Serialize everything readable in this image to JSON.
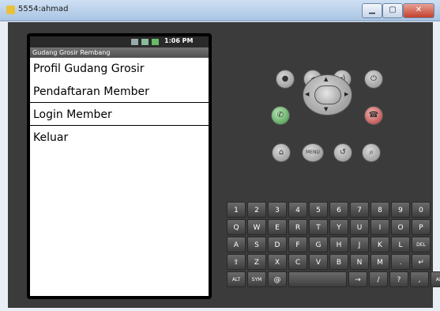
{
  "window": {
    "title": "5554:ahmad"
  },
  "status_bar": {
    "time": "1:06 PM"
  },
  "app": {
    "title": "Gudang Grosir Rembang",
    "menu": [
      "Profil Gudang Grosir",
      "Pendaftaran Member",
      "Login Member",
      "Keluar"
    ]
  },
  "controls": {
    "menu_label": "MENU",
    "dpad": {
      "up": "▲",
      "down": "▼",
      "left": "◀",
      "right": "▶"
    }
  },
  "keyboard": {
    "rows": [
      [
        "1",
        "2",
        "3",
        "4",
        "5",
        "6",
        "7",
        "8",
        "9",
        "0"
      ],
      [
        "Q",
        "W",
        "E",
        "R",
        "T",
        "Y",
        "U",
        "I",
        "O",
        "P"
      ],
      [
        "A",
        "S",
        "D",
        "F",
        "G",
        "H",
        "J",
        "K",
        "L",
        "DEL"
      ],
      [
        "⇧",
        "Z",
        "X",
        "C",
        "V",
        "B",
        "N",
        "M",
        ".",
        "↵"
      ],
      [
        "ALT",
        "SYM",
        "@",
        " ",
        "→",
        "/",
        "?",
        ",",
        "ALT"
      ]
    ]
  },
  "icons": [
    "app-icon",
    "signal-icon",
    "battery-icon",
    "camera-icon",
    "volume-down-icon",
    "volume-up-icon",
    "power-icon",
    "call-icon",
    "end-call-icon",
    "home-icon",
    "back-icon",
    "search-icon"
  ]
}
